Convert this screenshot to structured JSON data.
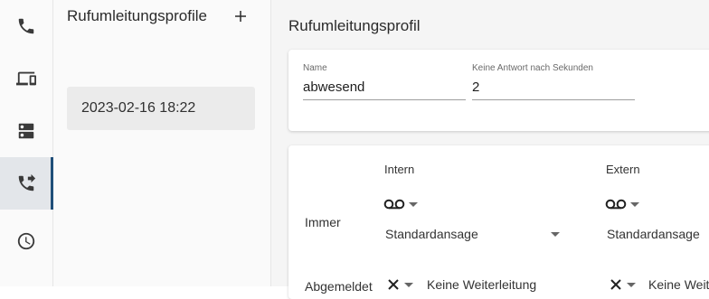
{
  "nav": {
    "items": [
      {
        "icon": "phone-icon",
        "active": false
      },
      {
        "icon": "devices-icon",
        "active": false
      },
      {
        "icon": "dns-icon",
        "active": false
      },
      {
        "icon": "phone-forwarded-icon",
        "active": true
      },
      {
        "icon": "clock-icon",
        "active": false
      }
    ],
    "accent": "#1f4e79"
  },
  "profiles": {
    "title": "Rufumleitungsprofile",
    "add_icon": "plus-icon",
    "items": [
      {
        "label": "2023-02-16 18:22"
      }
    ]
  },
  "main": {
    "title": "Rufumleitungsprofil",
    "name_field": {
      "label": "Name",
      "value": "abwesend"
    },
    "timeout_field": {
      "label": "Keine Antwort nach Sekunden",
      "value": "2"
    },
    "columns": {
      "intern": "Intern",
      "extern": "Extern"
    },
    "rows": [
      {
        "label": "Immer",
        "intern": {
          "icon": "voicemail-icon",
          "option": "Standardansage"
        },
        "extern": {
          "icon": "voicemail-icon",
          "option": "Standardansage"
        }
      },
      {
        "label": "Abgemeldet",
        "intern": {
          "icon": "close-icon",
          "option": "Keine Weiterleitung"
        },
        "extern": {
          "icon": "close-icon",
          "option": "Keine Weit"
        }
      }
    ]
  }
}
